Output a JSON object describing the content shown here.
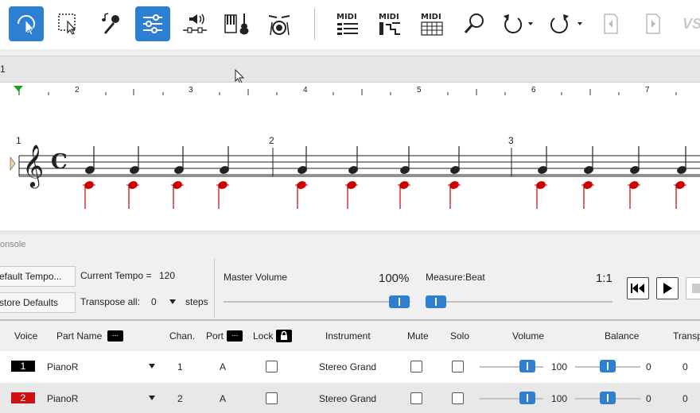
{
  "toolbar": {
    "buttons": [
      {
        "icon": "select-arrow-icon",
        "active": true
      },
      {
        "icon": "rect-select-icon",
        "active": false
      },
      {
        "icon": "microphone-notes-icon",
        "active": false
      },
      {
        "icon": "mixer-sliders-icon",
        "active": true
      },
      {
        "icon": "audio-waveform-icon",
        "active": false
      },
      {
        "icon": "instruments-icon",
        "active": false
      },
      {
        "icon": "drum-kit-icon",
        "active": false
      },
      {
        "icon": "midi-list-icon",
        "active": false,
        "label": "MIDI"
      },
      {
        "icon": "midi-steps-icon",
        "active": false,
        "label": "MIDI"
      },
      {
        "icon": "midi-grid-icon",
        "active": false,
        "label": "MIDI"
      },
      {
        "icon": "zoom-icon",
        "active": false
      },
      {
        "icon": "undo-icon",
        "active": false
      },
      {
        "icon": "redo-icon",
        "active": false
      },
      {
        "icon": "page-back-icon",
        "active": false
      },
      {
        "icon": "page-forward-icon",
        "active": false
      }
    ],
    "brand_partial": "VS"
  },
  "measure_strip": {
    "label": "1"
  },
  "ruler": {
    "ticks": [
      "2",
      "3",
      "4",
      "5",
      "6",
      "7"
    ]
  },
  "score": {
    "measure_numbers": [
      "1",
      "2",
      "3"
    ]
  },
  "console": {
    "label": "onsole",
    "default_tempo_btn": "efault Tempo...",
    "restore_defaults_btn": "store Defaults",
    "current_tempo_label": "Current Tempo =",
    "current_tempo_value": "120",
    "transpose_label": "Transpose all:",
    "transpose_value": "0",
    "transpose_unit": "steps",
    "master_volume_label": "Master Volume",
    "master_volume_value": "100%",
    "measure_beat_label": "Measure:Beat",
    "measure_beat_value": "1:1"
  },
  "table": {
    "headers": {
      "voice": "Voice",
      "part_name": "Part Name",
      "chan": "Chan.",
      "port": "Port",
      "lock": "Lock",
      "instrument": "Instrument",
      "mute": "Mute",
      "solo": "Solo",
      "volume": "Volume",
      "balance": "Balance",
      "transpose": "Transp"
    },
    "dots": "...",
    "rows": [
      {
        "voice": "1",
        "voice_color": "#000000",
        "part": "PianoR",
        "chan": "1",
        "port": "A",
        "instrument": "Stereo Grand",
        "volume": "100",
        "balance": "0",
        "transpose": "0"
      },
      {
        "voice": "2",
        "voice_color": "#cc1111",
        "part": "PianoR",
        "chan": "2",
        "port": "A",
        "instrument": "Stereo Grand",
        "volume": "100",
        "balance": "0",
        "transpose": "0"
      }
    ]
  },
  "colors": {
    "accent": "#2d7fd1",
    "note_red": "#cc0000"
  }
}
